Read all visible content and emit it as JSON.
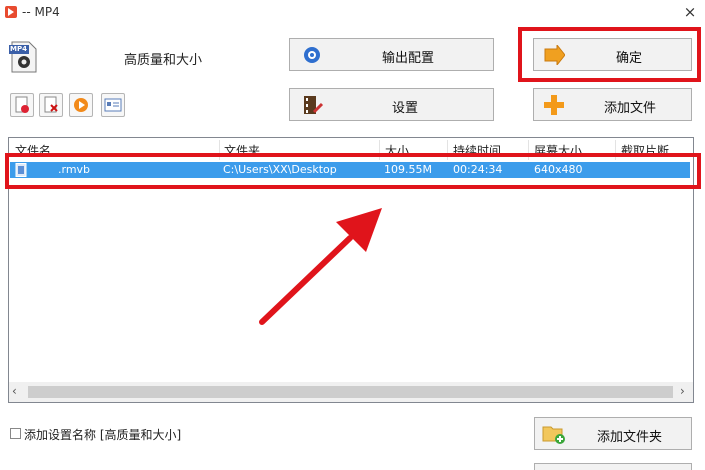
{
  "window": {
    "title": "-- MP4",
    "close_glyph": "×"
  },
  "format": {
    "icon": "mp4-file-icon",
    "icon_text": "MP4",
    "quality_label": "高质量和大小"
  },
  "buttons": {
    "output_config": "输出配置",
    "settings": "设置",
    "confirm": "确定",
    "add_file": "添加文件",
    "add_folder": "添加文件夹"
  },
  "toolbar": [
    "delete-icon",
    "remove-icon",
    "play-icon",
    "info-icon"
  ],
  "table": {
    "headers": [
      "文件名",
      "文件夹",
      "大小",
      "持续时间",
      "屏幕大小",
      "截取片断"
    ],
    "rows": [
      {
        "name": ".rmvb",
        "folder": "C:\\Users\\XX\\Desktop",
        "size": "109.55M",
        "duration": "00:24:34",
        "screen": "640x480"
      }
    ]
  },
  "footer": {
    "checkbox_label": "添加设置名称 [高质量和大小]"
  },
  "colors": {
    "accent_red": "#e0141b",
    "selection_blue": "#3c9ceb"
  }
}
